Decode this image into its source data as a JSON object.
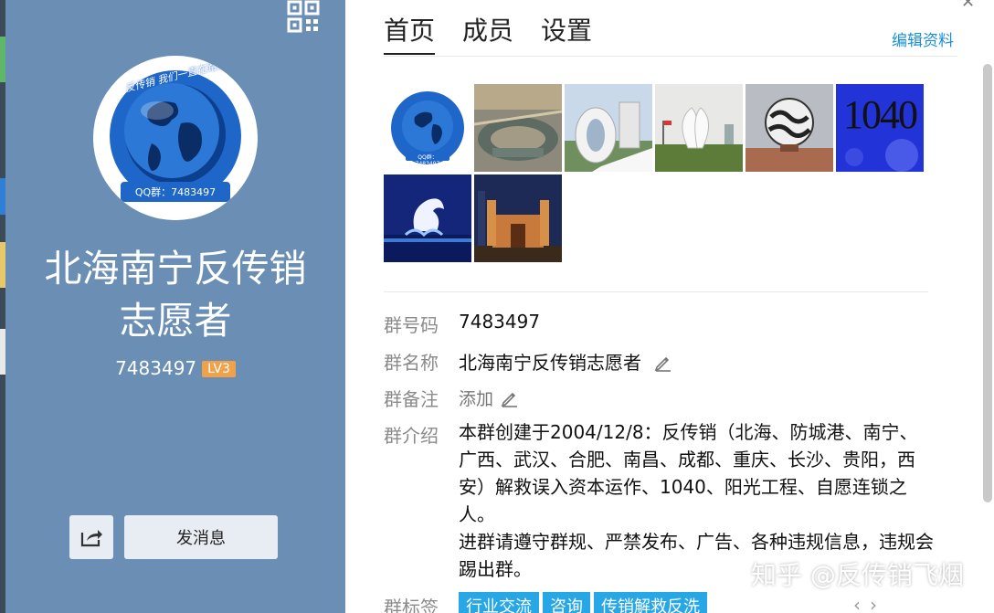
{
  "side": {
    "name_line1": "北海南宁反传销",
    "name_line2": "志愿者",
    "group_id": "7483497",
    "level": "LV3",
    "logo_top_text": "反传销 我们一直在路上",
    "logo_bottom_text": "QQ群：7483497",
    "send_message": "发消息"
  },
  "tabs": [
    {
      "label": "首页",
      "active": true
    },
    {
      "label": "成员",
      "active": false
    },
    {
      "label": "设置",
      "active": false
    }
  ],
  "edit_profile": "编辑资料",
  "photos": {
    "number_tile_text": "1040",
    "small_logo_text": "QQ群：7483497"
  },
  "info": {
    "id_label": "群号码",
    "id_value": "7483497",
    "name_label": "群名称",
    "name_value": "北海南宁反传销志愿者",
    "remark_label": "群备注",
    "remark_value": "添加",
    "intro_label": "群介绍",
    "intro_p1": "本群创建于2004/12/8：反传销（北海、防城港、南宁、广西、武汉、合肥、南昌、成都、重庆、长沙、贵阳，西安）解救误入资本运作、1040、阳光工程、自愿连锁之人。",
    "intro_p2": "进群请遵守群规、严禁发布、广告、各种违规信息，违规会踢出群。",
    "tags_label": "群标签",
    "tags": [
      "行业交流",
      "咨询",
      "传销解救反洗"
    ]
  },
  "watermark": "知乎 @反传销飞烟",
  "colors": {
    "side_bg": "#6a8eb4",
    "level_badge": "#f0a24a",
    "link": "#1a8fd6",
    "tag_bg": "#27a7e6"
  },
  "icons": {
    "qr": "qr-code-icon",
    "share": "share-icon",
    "edit": "pencil-icon"
  }
}
